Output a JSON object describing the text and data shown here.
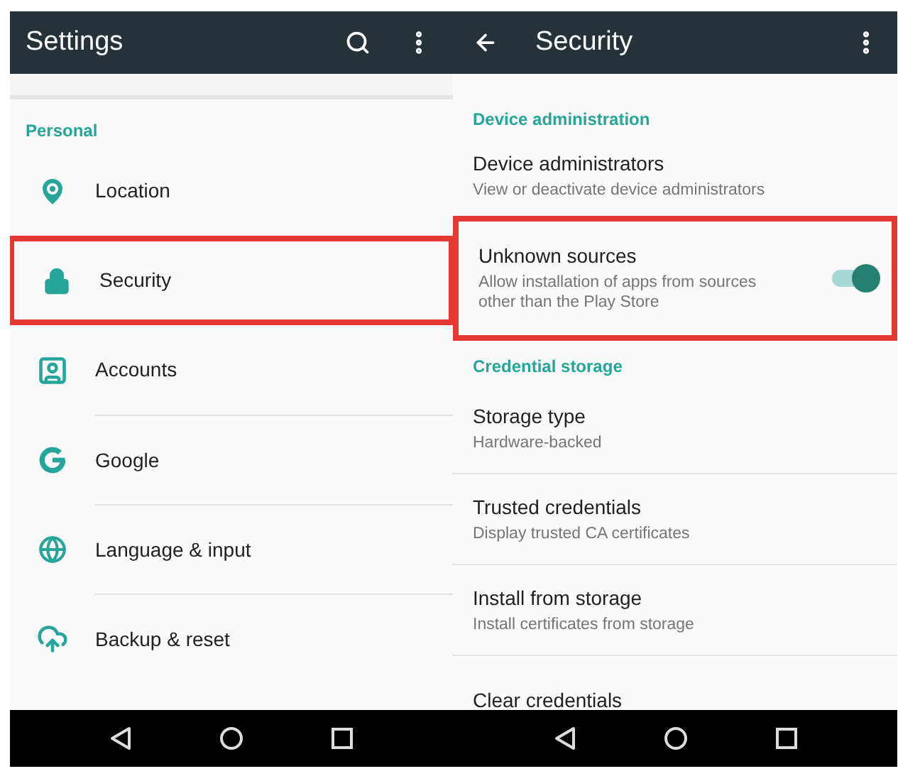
{
  "settings_screen": {
    "title": "Settings",
    "section": "Personal",
    "items": [
      {
        "label": "Location",
        "highlighted": false
      },
      {
        "label": "Security",
        "highlighted": true
      },
      {
        "label": "Accounts",
        "highlighted": false
      },
      {
        "label": "Google",
        "highlighted": false
      },
      {
        "label": "Language & input",
        "highlighted": false
      },
      {
        "label": "Backup & reset",
        "highlighted": false
      }
    ]
  },
  "security_screen": {
    "title": "Security",
    "sections": [
      {
        "header": "Device administration",
        "items": [
          {
            "title": "Device administrators",
            "subtitle": "View or deactivate device administrators",
            "highlighted": false
          },
          {
            "title": "Unknown sources",
            "subtitle": "Allow installation of apps from sources other than the Play Store",
            "highlighted": true,
            "on": true
          }
        ]
      },
      {
        "header": "Credential storage",
        "items": [
          {
            "title": "Storage type",
            "subtitle": "Hardware-backed",
            "highlighted": false
          },
          {
            "title": "Trusted credentials",
            "subtitle": "Display trusted CA certificates",
            "highlighted": false
          },
          {
            "title": "Install from storage",
            "subtitle": "Install certificates from storage",
            "highlighted": false
          },
          {
            "title": "Clear credentials",
            "highlighted": false
          }
        ]
      }
    ]
  }
}
